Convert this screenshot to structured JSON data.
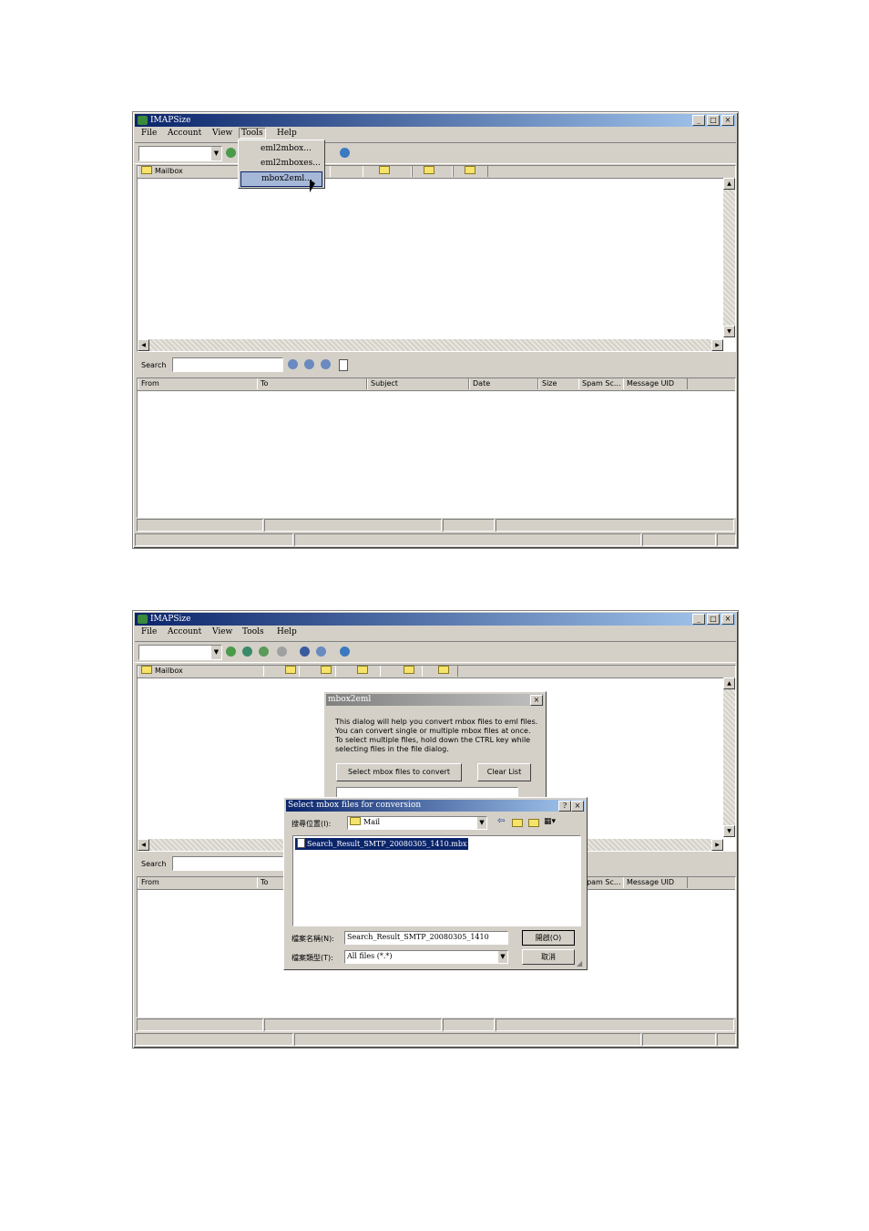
{
  "screen1": {
    "title": "IMAPSize",
    "window_buttons": [
      "_",
      "□",
      "×"
    ],
    "menu": [
      "File",
      "Account",
      "View",
      "Tools",
      "Help"
    ],
    "tools_menu": [
      "eml2mbox...",
      "eml2mboxes...",
      "mbox2eml..."
    ],
    "mailbox_header": "Mailbox",
    "search_label": "Search",
    "columns": [
      "From",
      "To",
      "Subject",
      "Date",
      "Size",
      "Spam Sc...",
      "Message UID"
    ]
  },
  "screen2": {
    "title": "IMAPSize",
    "window_buttons": [
      "_",
      "□",
      "×"
    ],
    "menu": [
      "File",
      "Account",
      "View",
      "Tools",
      "Help"
    ],
    "mailbox_header": "Mailbox",
    "search_label": "Search",
    "columns": [
      "From",
      "To",
      "Spam Sc...",
      "Message UID"
    ],
    "mbox_dialog": {
      "title": "mbox2eml",
      "close": "×",
      "description_lines": [
        "This dialog will help you convert mbox files to eml files.",
        "You can convert single or multiple mbox files at once.",
        "To select multiple files, hold down the CTRL key while",
        "selecting files in the file dialog."
      ],
      "select_button": "Select mbox files to convert",
      "clear_button": "Clear List"
    },
    "file_dialog": {
      "title": "Select mbox files for conversion",
      "help": "?",
      "close": "×",
      "look_in_label": "搜尋位置(I):",
      "look_in_value": "Mail",
      "file_item": "Search_Result_SMTP_20080305_1410.mbx",
      "filename_label": "檔案名稱(N):",
      "filename_value": "Search_Result_SMTP_20080305_1410",
      "filetype_label": "檔案類型(T):",
      "filetype_value": "All files (*.*)",
      "open_button": "開啟(O)",
      "cancel_button": "取消"
    }
  }
}
